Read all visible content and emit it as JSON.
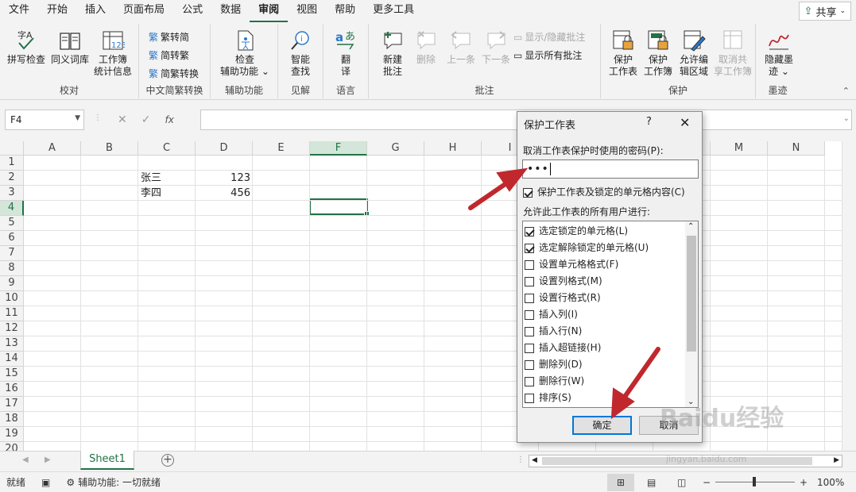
{
  "menu": {
    "tabs": [
      "文件",
      "开始",
      "插入",
      "页面布局",
      "公式",
      "数据",
      "审阅",
      "视图",
      "帮助",
      "更多工具"
    ],
    "active": "审阅",
    "share": "共享"
  },
  "ribbon": {
    "proofing": {
      "label": "校对",
      "spell": "拼写检查",
      "thesaurus": "同义词库",
      "stats1": "工作簿",
      "stats2": "统计信息"
    },
    "chinese": {
      "label": "中文简繁转换",
      "to_trad": "繁转简",
      "to_simp": "简转繁",
      "convert": "简繁转换"
    },
    "accessibility": {
      "label": "辅助功能",
      "check1": "检查",
      "check2": "辅助功能"
    },
    "insights": {
      "label": "见解",
      "smart1": "智能",
      "smart2": "查找"
    },
    "language": {
      "label": "语言",
      "translate1": "翻",
      "translate2": "译"
    },
    "comments": {
      "label": "批注",
      "new1": "新建",
      "new2": "批注",
      "delete": "删除",
      "prev": "上一条",
      "next": "下一条",
      "show_hide": "显示/隐藏批注",
      "show_all": "显示所有批注"
    },
    "protect": {
      "label": "保护",
      "sheet1": "保护",
      "sheet2": "工作表",
      "book1": "保护",
      "book2": "工作簿",
      "edit1": "允许编",
      "edit2": "辑区域",
      "unshare1": "取消共",
      "unshare2": "享工作簿"
    },
    "ink": {
      "label": "墨迹",
      "hide1": "隐藏墨",
      "hide2": "迹"
    }
  },
  "formula_bar": {
    "name_box": "F4",
    "fx": "fx",
    "value": ""
  },
  "grid": {
    "columns": [
      "A",
      "B",
      "C",
      "D",
      "E",
      "F",
      "G",
      "H",
      "I",
      "J",
      "K",
      "L",
      "M",
      "N"
    ],
    "rows": [
      "1",
      "2",
      "3",
      "4",
      "5",
      "6",
      "7",
      "8",
      "9",
      "10",
      "11",
      "12",
      "13",
      "14",
      "15",
      "16",
      "17",
      "18",
      "19",
      "20"
    ],
    "selected_col": "F",
    "selected_row": "4",
    "c2": "张三",
    "d2": "123",
    "c3": "李四",
    "d3": "456"
  },
  "sheets": {
    "tab": "Sheet1"
  },
  "status": {
    "ready": "就绪",
    "accessibility": "辅助功能: 一切就绪",
    "zoom": "100%"
  },
  "dialog": {
    "title": "保护工作表",
    "help": "?",
    "password_label": "取消工作表保护时使用的密码(P):",
    "password_value": "•••",
    "protect_check": "保护工作表及锁定的单元格内容(C)",
    "allow_label": "允许此工作表的所有用户进行:",
    "permissions": [
      {
        "label": "选定锁定的单元格(L)",
        "checked": true
      },
      {
        "label": "选定解除锁定的单元格(U)",
        "checked": true
      },
      {
        "label": "设置单元格格式(F)",
        "checked": false
      },
      {
        "label": "设置列格式(M)",
        "checked": false
      },
      {
        "label": "设置行格式(R)",
        "checked": false
      },
      {
        "label": "插入列(I)",
        "checked": false
      },
      {
        "label": "插入行(N)",
        "checked": false
      },
      {
        "label": "插入超链接(H)",
        "checked": false
      },
      {
        "label": "删除列(D)",
        "checked": false
      },
      {
        "label": "删除行(W)",
        "checked": false
      },
      {
        "label": "排序(S)",
        "checked": false
      }
    ],
    "ok": "确定",
    "cancel": "取消"
  },
  "watermark": {
    "text": "Baidu经验",
    "url": "jingyan.baidu.com"
  },
  "colors": {
    "accent": "#217346",
    "arrow": "#c0282d",
    "primary_btn": "#0078d7"
  }
}
